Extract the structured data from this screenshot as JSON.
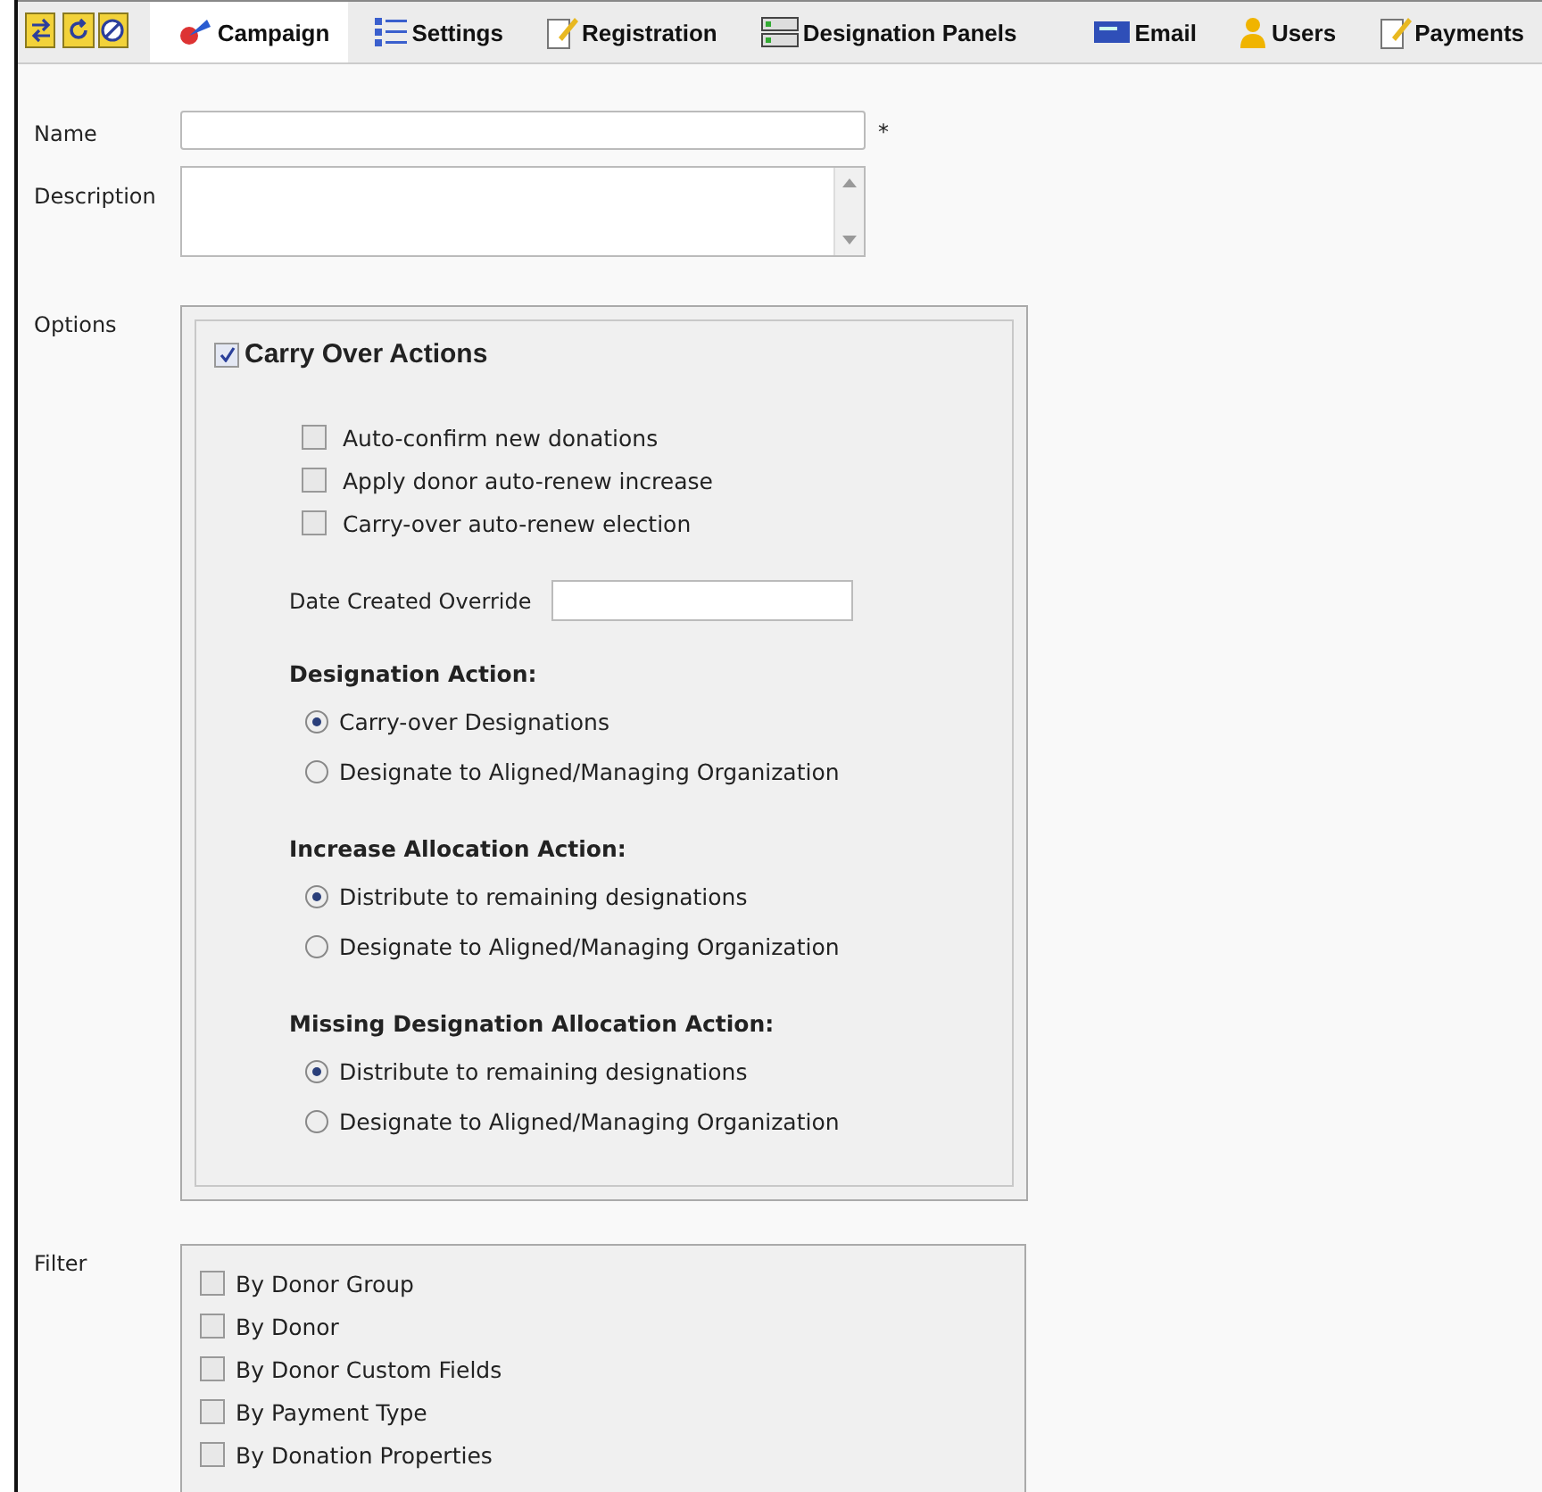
{
  "toolbar": {
    "tabs": [
      {
        "label": "Campaign",
        "selected": true
      },
      {
        "label": "Settings",
        "selected": false
      },
      {
        "label": "Registration",
        "selected": false
      },
      {
        "label": "Designation Panels",
        "selected": false
      },
      {
        "label": "Email",
        "selected": false
      },
      {
        "label": "Users",
        "selected": false
      },
      {
        "label": "Payments",
        "selected": false
      }
    ]
  },
  "name": {
    "label": "Name",
    "required": "*"
  },
  "description": {
    "label": "Description"
  },
  "options": {
    "label": "Options",
    "carry_over": {
      "label": "Carry Over Actions",
      "checked": true
    },
    "checkboxes": [
      {
        "label": "Auto-confirm new donations",
        "checked": false
      },
      {
        "label": "Apply donor auto-renew increase",
        "checked": false
      },
      {
        "label": "Carry-over auto-renew election",
        "checked": false
      }
    ],
    "date_override": {
      "label": "Date Created Override"
    },
    "groups": [
      {
        "title": "Designation Action:",
        "choices": [
          {
            "label": "Carry-over Designations",
            "selected": true
          },
          {
            "label": "Designate to Aligned/Managing Organization",
            "selected": false
          }
        ]
      },
      {
        "title": "Increase Allocation Action:",
        "choices": [
          {
            "label": "Distribute to remaining designations",
            "selected": true
          },
          {
            "label": "Designate to Aligned/Managing Organization",
            "selected": false
          }
        ]
      },
      {
        "title": "Missing Designation Allocation Action:",
        "choices": [
          {
            "label": "Distribute to remaining designations",
            "selected": true
          },
          {
            "label": "Designate to Aligned/Managing Organization",
            "selected": false
          }
        ]
      }
    ]
  },
  "filter": {
    "label": "Filter",
    "items": [
      {
        "label": "By Donor Group",
        "checked": false
      },
      {
        "label": "By Donor",
        "checked": false
      },
      {
        "label": "By Donor Custom Fields",
        "checked": false
      },
      {
        "label": "By Payment Type",
        "checked": false
      },
      {
        "label": "By Donation Properties",
        "checked": false
      }
    ]
  }
}
